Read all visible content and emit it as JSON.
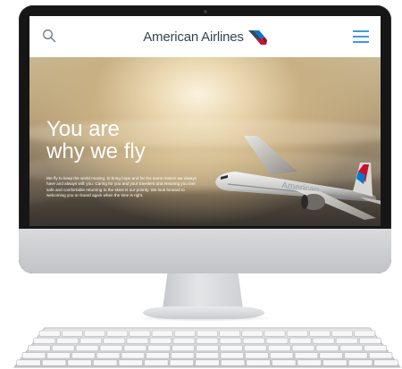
{
  "site": {
    "brand": "American Airlines",
    "brand_colors": {
      "red": "#c8102e",
      "blue": "#0078d2",
      "navy": "#36495a",
      "text": "#38454f"
    }
  },
  "header": {
    "search_icon": "search-icon",
    "menu_icon": "hamburger-menu-icon"
  },
  "hero": {
    "title_line1": "You are",
    "title_line2": "why we fly",
    "body": "We fly to keep the world moving, to bring hope and for the same reason we always have and always will: you. Caring for you and your travelers and ensuring you feel safe and comfortable returning to the skies is our priority. We look forward to welcoming you on board again when the time is right.",
    "plane_livery": "American"
  }
}
